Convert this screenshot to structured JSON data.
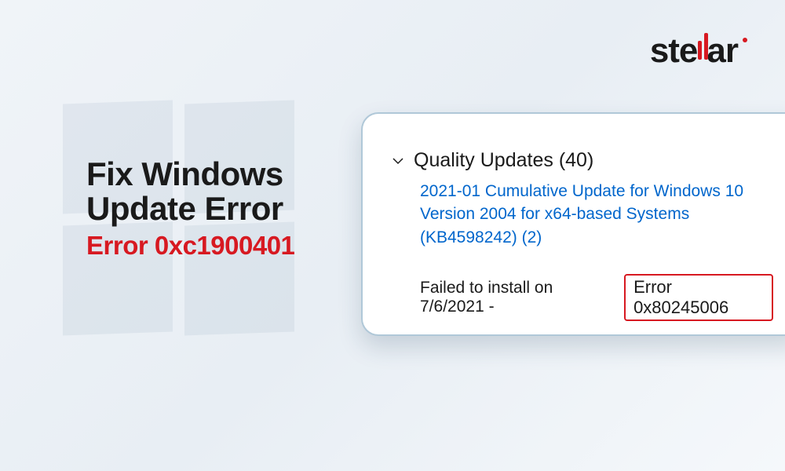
{
  "brand": {
    "name_part1": "ste",
    "name_part2": "ar"
  },
  "headline": {
    "line1": "Fix Windows",
    "line2": "Update Error",
    "subtitle": "Error 0xc1900401"
  },
  "card": {
    "section_title": "Quality Updates (40)",
    "update_name": "2021-01 Cumulative Update for Windows 10 Version 2004 for x64-based Systems (KB4598242) (2)",
    "status_text": "Failed to install on 7/6/2021 -",
    "error_code": "Error 0x80245006"
  }
}
